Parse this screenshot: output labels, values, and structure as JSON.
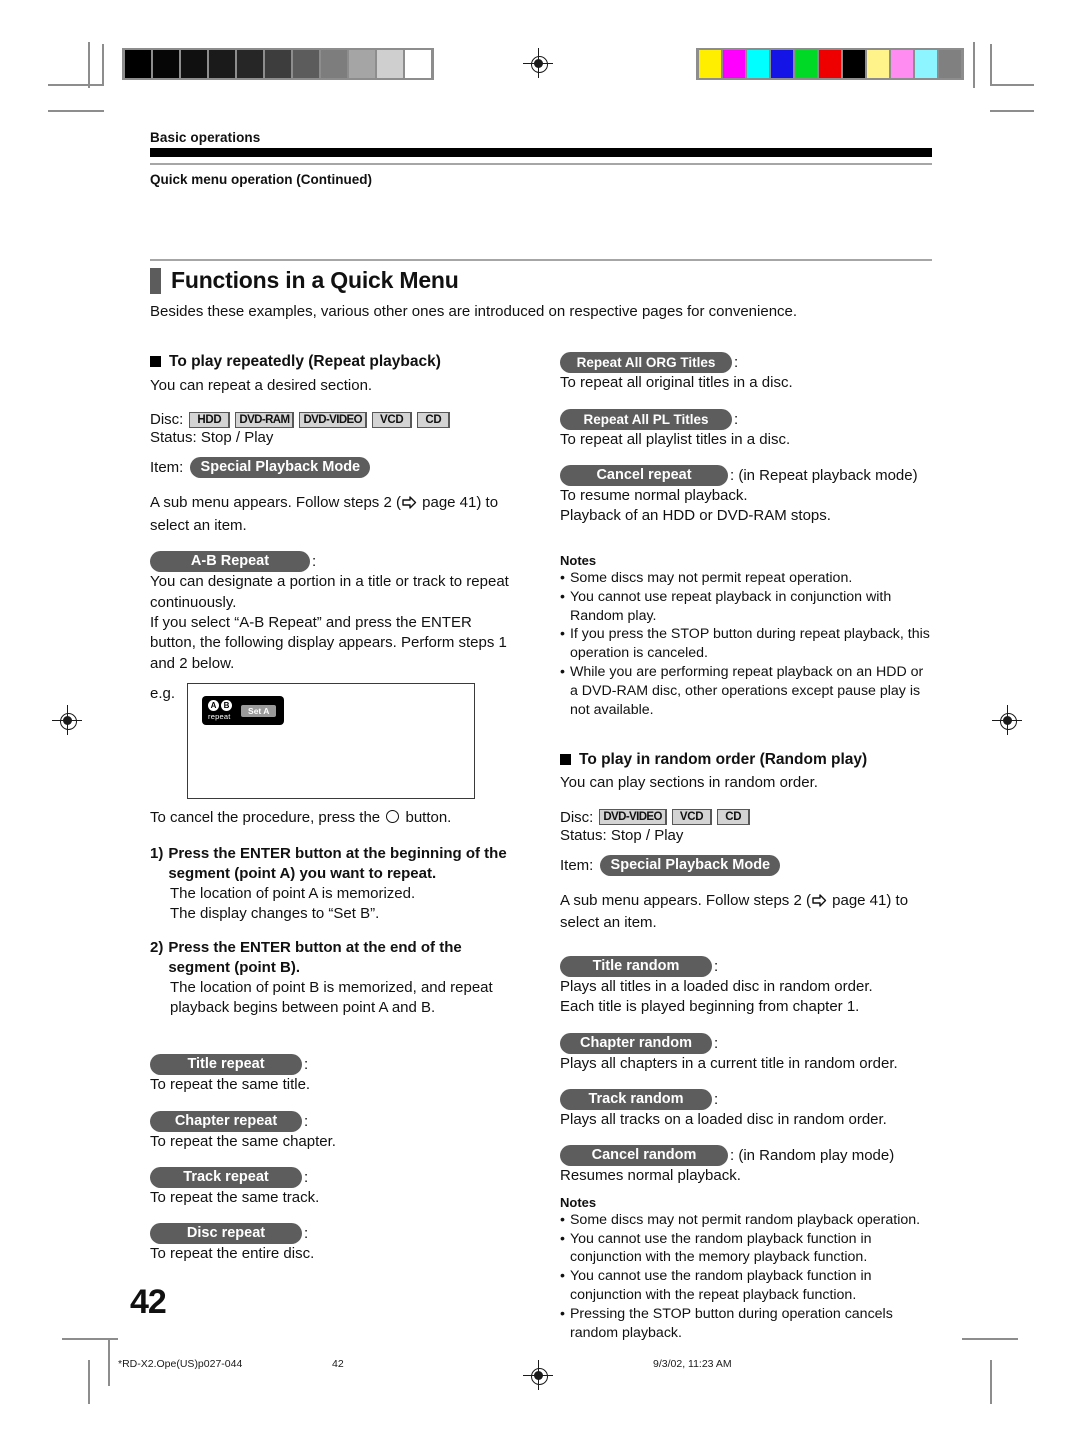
{
  "header": {
    "kicker": "Basic operations",
    "subkicker": "Quick menu operation (Continued)"
  },
  "section": {
    "title": "Functions in a Quick Menu",
    "intro": "Besides these examples, various other ones are introduced on respective pages for convenience."
  },
  "left": {
    "repeat_heading": "To play repeatedly (Repeat playback)",
    "repeat_lead": "You can repeat a desired section.",
    "disc_label": "Disc:",
    "disc_badges": [
      "HDD",
      "DVD-RAM",
      "DVD-VIDEO",
      "VCD",
      "CD"
    ],
    "status_line": "Status: Stop / Play",
    "item_label": "Item:",
    "item_pill": "Special Playback Mode",
    "submenu_1": "A sub menu appears. Follow steps 2 (",
    "submenu_2": " page 41) to",
    "submenu_3": "select an item.",
    "ab_pill": "A-B Repeat",
    "ab_body_1": "You can designate a portion in a title or track to repeat",
    "ab_body_2": "continuously.",
    "ab_body_3": "If you select “A-B Repeat” and press the ENTER",
    "ab_body_4": "button, the following display appears. Perform steps 1",
    "ab_body_5": "and 2 below.",
    "eg_label": "e.g.",
    "osd": {
      "a": "A",
      "b": "B",
      "repeat": "repeat",
      "set": "Set A"
    },
    "cancel_1": "To cancel the procedure, press the ",
    "cancel_2": " button.",
    "steps": [
      {
        "num": "1)",
        "head_1": "Press the ENTER button at the beginning of the",
        "head_2": "segment (point A) you want to repeat.",
        "body_1": "The location of point A is memorized.",
        "body_2": "The display changes to “Set B”."
      },
      {
        "num": "2)",
        "head_1": "Press the ENTER button at the end of the",
        "head_2": "segment (point B).",
        "body_1": "The location of point B is memorized, and repeat",
        "body_2": "playback begins between point A and B."
      }
    ],
    "options": [
      {
        "pill": "Title repeat",
        "desc": "To repeat the same title."
      },
      {
        "pill": "Chapter repeat",
        "desc": "To repeat the same chapter."
      },
      {
        "pill": "Track repeat",
        "desc": "To repeat the same track."
      },
      {
        "pill": "Disc repeat",
        "desc": "To repeat the entire disc."
      }
    ]
  },
  "right": {
    "repeat_options": [
      {
        "pill": "Repeat All ORG Titles",
        "tail": ":",
        "desc_1": "To repeat all original titles in a disc.",
        "desc_2": ""
      },
      {
        "pill": "Repeat All PL Titles",
        "tail": ":",
        "desc_1": "To repeat all playlist titles in a disc.",
        "desc_2": ""
      },
      {
        "pill": "Cancel repeat",
        "tail": ": (in Repeat playback mode)",
        "desc_1": "To resume normal playback.",
        "desc_2": "Playback of an HDD or DVD-RAM stops."
      }
    ],
    "notes_repeat_heading": "Notes",
    "notes_repeat": [
      "Some discs may not permit repeat operation.",
      "You cannot use repeat playback in conjunction with Random play.",
      "If you press the STOP button during repeat playback, this operation is canceled.",
      "While you are performing repeat playback on an HDD or a DVD-RAM disc, other operations except pause play is not available."
    ],
    "random_heading": "To play in random order (Random play)",
    "random_lead": "You can play sections in random order.",
    "disc_label": "Disc:",
    "disc_badges": [
      "DVD-VIDEO",
      "VCD",
      "CD"
    ],
    "status_line": "Status: Stop / Play",
    "item_label": "Item:",
    "item_pill": "Special Playback Mode",
    "submenu_1": "A sub menu appears. Follow steps 2 (",
    "submenu_2": " page 41) to",
    "submenu_3": "select an item.",
    "random_options": [
      {
        "pill": "Title random",
        "tail": ":",
        "desc_1": "Plays all titles in a loaded disc in random order.",
        "desc_2": "Each title is played beginning from chapter 1."
      },
      {
        "pill": "Chapter random",
        "tail": ":",
        "desc_1": "Plays all chapters in a current title in random order.",
        "desc_2": ""
      },
      {
        "pill": "Track random",
        "tail": ":",
        "desc_1": "Plays all tracks on a loaded disc in random order.",
        "desc_2": ""
      },
      {
        "pill": "Cancel random",
        "tail": ": (in Random play mode)",
        "desc_1": "Resumes normal playback.",
        "desc_2": ""
      }
    ],
    "notes_random_heading": "Notes",
    "notes_random": [
      "Some discs may not permit random playback operation.",
      "You cannot use the random playback function in conjunction with the memory playback function.",
      "You cannot use the random playback function in conjunction with the repeat playback function.",
      "Pressing the STOP button during operation cancels random playback."
    ]
  },
  "page_number": "42",
  "footer": {
    "left": "*RD-X2.Ope(US)p027-044",
    "center": "42",
    "right": "9/3/02, 11:23 AM"
  },
  "marks": {
    "gray_patches": [
      "#000000",
      "#060606",
      "#101010",
      "#1a1a1a",
      "#262626",
      "#3d3d3d",
      "#5c5c5c",
      "#7d7d7d",
      "#a5a5a5",
      "#cfcfcf",
      "#ffffff"
    ],
    "color_patches": [
      "#ffee00",
      "#ff00ff",
      "#00ffff",
      "#1414e6",
      "#00d926",
      "#ee0000",
      "#000000",
      "#fff389",
      "#ff8cf0",
      "#8cf5ff",
      "#808080"
    ]
  }
}
